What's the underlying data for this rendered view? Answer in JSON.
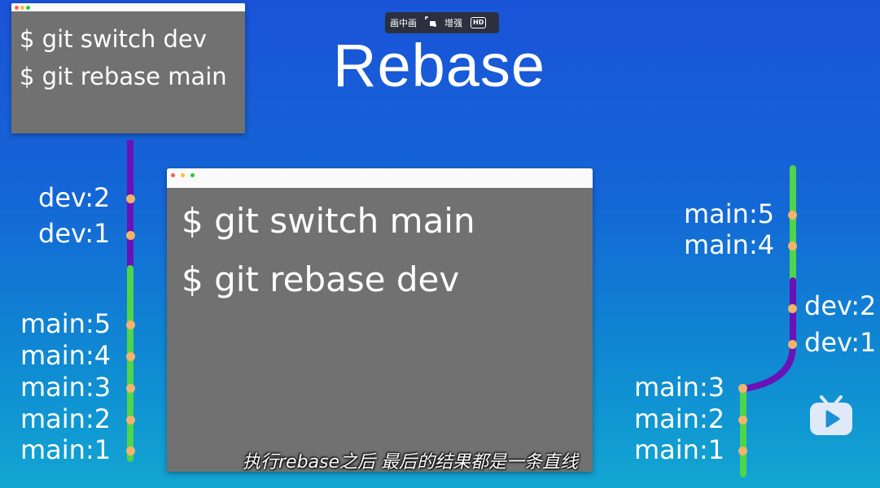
{
  "player": {
    "pip_label": "画中画",
    "enhance_label": "增强",
    "hd_label": "HD"
  },
  "title": "Rebase",
  "terminals": {
    "small": {
      "line1": "$ git switch dev",
      "line2": "$ git rebase main"
    },
    "main": {
      "line1": "$ git switch main",
      "line2": "$ git rebase dev"
    }
  },
  "left_graph": {
    "dev": [
      "dev:2",
      "dev:1"
    ],
    "main": [
      "main:5",
      "main:4",
      "main:3",
      "main:2",
      "main:1"
    ]
  },
  "right_graph": {
    "main_top": [
      "main:5",
      "main:4"
    ],
    "dev": [
      "dev:2",
      "dev:1"
    ],
    "main_bottom": [
      "main:3",
      "main:2",
      "main:1"
    ]
  },
  "subtitle": "执行rebase之后 最后的结果都是一条直线",
  "colors": {
    "dev_branch": "#6a12b8",
    "main_branch": "#4fd44a",
    "commit": "#f0b46a",
    "terminal_bg": "#717171"
  },
  "icons": {
    "logo": "tv-icon"
  }
}
